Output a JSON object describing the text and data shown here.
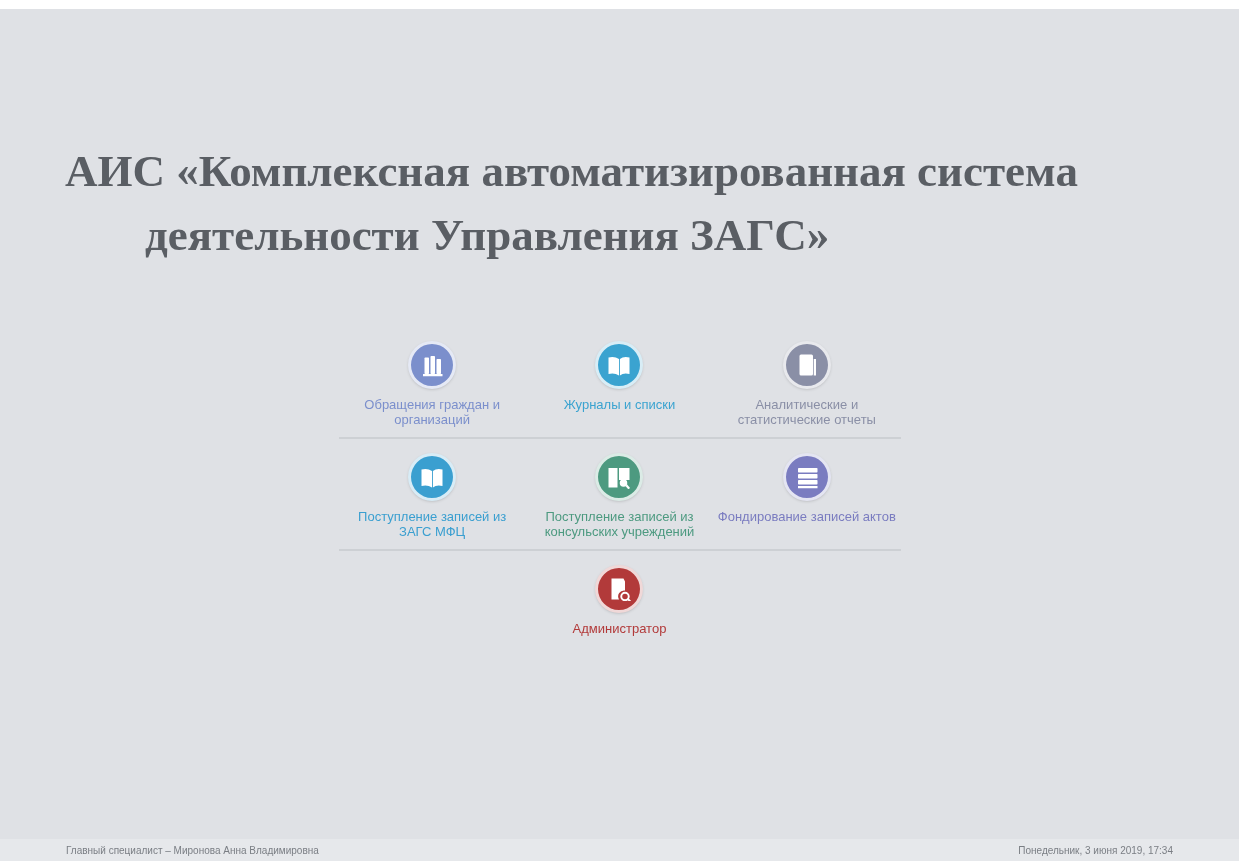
{
  "title_lines": [
    "АИС «Комплексная автоматизированная система",
    "деятельности Управления ЗАГС»"
  ],
  "menu_rows": [
    {
      "items": [
        {
          "label": "Обращения граждан и организаций",
          "kind": "books",
          "color": "#7b8fcc"
        },
        {
          "label": "Журналы и списки",
          "kind": "book",
          "color": "#3aa3d0"
        },
        {
          "label": "Аналитические и статистические отчеты",
          "kind": "document",
          "color": "#8a8fa6"
        }
      ]
    },
    {
      "items": [
        {
          "label": "Поступление записей из ЗАГС МФЦ",
          "kind": "book",
          "color": "#3a9fd0"
        },
        {
          "label": "Поступление записей из консульских учреждений",
          "kind": "book-search",
          "color": "#4d9a80"
        },
        {
          "label": "Фондирование записей актов",
          "kind": "stack",
          "color": "#7a7cc0"
        }
      ]
    },
    {
      "items": [
        {
          "label": "Администратор",
          "kind": "document-search",
          "color": "#b23a3a"
        }
      ]
    }
  ],
  "status_bar": {
    "user": "Главный специалист – Миронова Анна Владимировна",
    "datetime": "Понедельник, 3 июня 2019, 17:34"
  }
}
